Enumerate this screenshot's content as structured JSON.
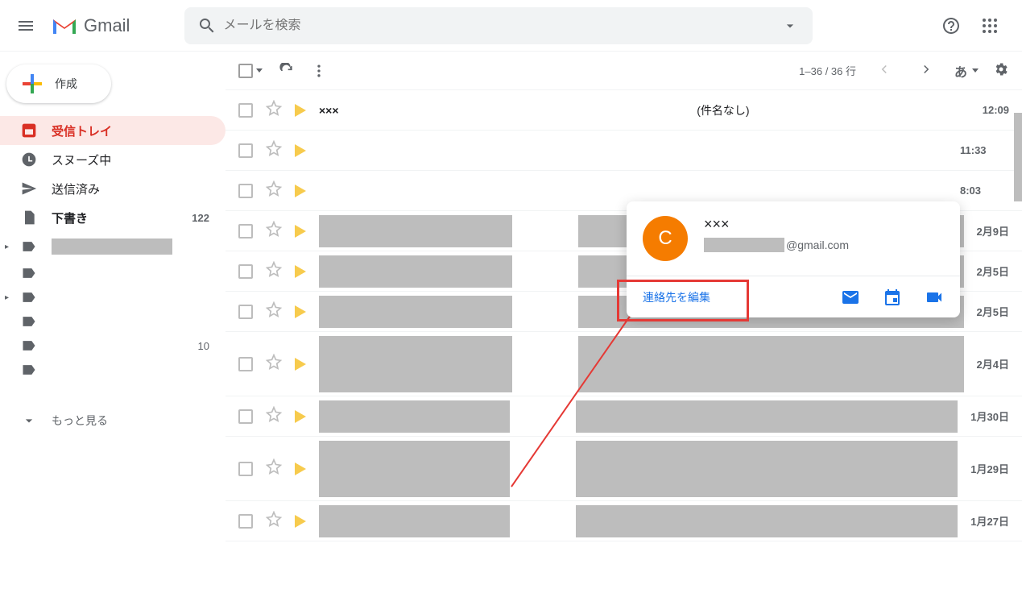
{
  "header": {
    "app_name": "Gmail",
    "search_placeholder": "メールを検索"
  },
  "sidebar": {
    "compose": "作成",
    "items": [
      {
        "label": "受信トレイ"
      },
      {
        "label": "スヌーズ中"
      },
      {
        "label": "送信済み"
      },
      {
        "label": "下書き",
        "count": "122"
      }
    ],
    "label_count_1": "10",
    "more": "もっと見る"
  },
  "toolbar": {
    "range": "1–36 / 36 行",
    "lang": "あ"
  },
  "rows": [
    {
      "sender": "×××",
      "subject": "(件名なし)",
      "date": "12:09"
    },
    {
      "date": "11:33"
    },
    {
      "date": "8:03"
    },
    {
      "date": "2月9日"
    },
    {
      "date": "2月5日"
    },
    {
      "date": "2月5日"
    },
    {
      "date": "2月4日"
    },
    {
      "date": "1月30日"
    },
    {
      "date": "1月29日"
    },
    {
      "date": "1月27日"
    }
  ],
  "hovercard": {
    "avatar": "C",
    "name": "×××",
    "email_suffix": "@gmail.com",
    "edit": "連絡先を編集"
  }
}
